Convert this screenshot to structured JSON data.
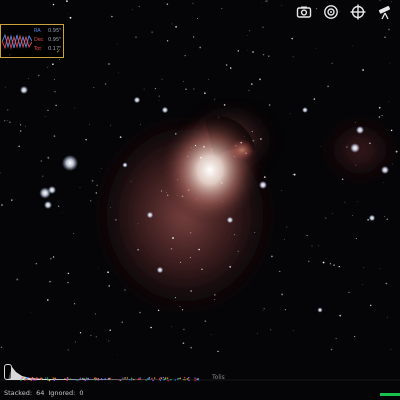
{
  "guiding": {
    "rows": [
      {
        "key": "RA",
        "value": "0.95\""
      },
      {
        "key": "Dec",
        "value": "0.95\""
      },
      {
        "key": "Tot",
        "value": "0.17\""
      }
    ],
    "mark": "✓"
  },
  "toolbar": {
    "icons": [
      "camera-icon",
      "target-icon",
      "crosshair-icon",
      "telescope-icon"
    ]
  },
  "histogram": {
    "label": "Tolis"
  },
  "status": {
    "stacked_label": "Stacked:",
    "stacked_value": "64",
    "ignored_label": "Ignored:",
    "ignored_value": "0"
  },
  "progress": {
    "fraction": 1.0,
    "color": "#19c24a"
  },
  "colors": {
    "nebula_core": "#f4eee6",
    "nebula_mid": "#b8756a",
    "nebula_outer": "#5a2a2a",
    "panel_border": "#caa43a"
  }
}
